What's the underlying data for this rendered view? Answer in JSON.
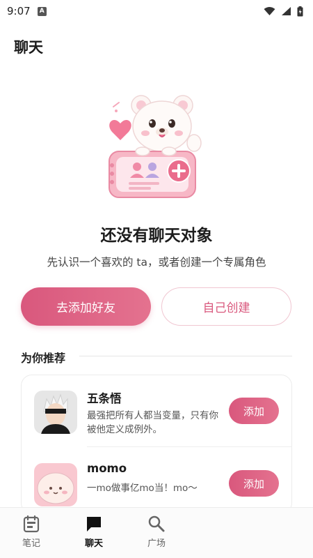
{
  "status_bar": {
    "time": "9:07",
    "notification_icon": "a-icon",
    "wifi_icon": "wifi-icon",
    "signal_icon": "signal-icon",
    "battery_icon": "battery-icon"
  },
  "header": {
    "title": "聊天"
  },
  "empty_state": {
    "illustration": "bear-with-card-illustration",
    "title": "还没有聊天对象",
    "subtitle": "先认识一个喜欢的 ta，或者创建一个专属角色"
  },
  "actions": {
    "add_friend_label": "去添加好友",
    "create_own_label": "自己创建"
  },
  "recommend": {
    "section_title": "为你推荐",
    "items": [
      {
        "name": "五条悟",
        "desc": "最强把所有人都当变量，只有你被他定义成例外。",
        "button": "添加",
        "avatar": "gojo-avatar"
      },
      {
        "name": "momo",
        "desc": "一mo做事亿mo当！mo～",
        "button": "添加",
        "avatar": "momo-avatar"
      }
    ]
  },
  "bottom_nav": {
    "items": [
      {
        "label": "笔记",
        "icon": "notes-icon"
      },
      {
        "label": "聊天",
        "icon": "chat-icon"
      },
      {
        "label": "广场",
        "icon": "search-icon"
      }
    ]
  },
  "colors": {
    "accent": "#d9587d",
    "accent_light": "#e4728f",
    "border_pink": "#f0c6d1"
  }
}
